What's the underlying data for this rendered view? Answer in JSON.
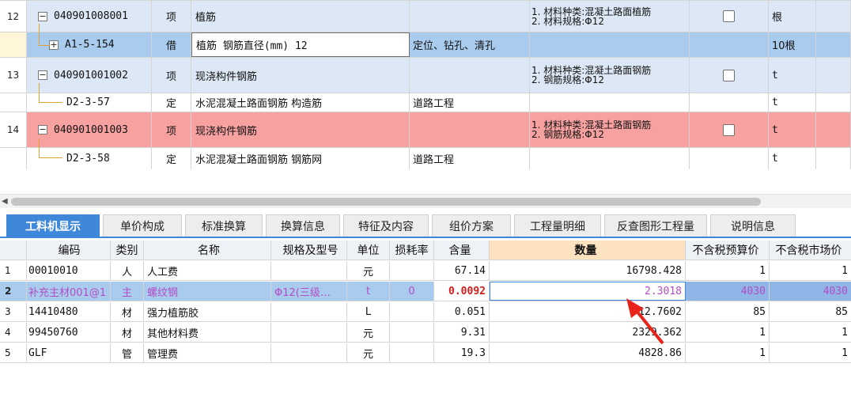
{
  "colors": {
    "accent": "#3f87d8",
    "row_highlight": "#a9cbee",
    "row_red": "#f7a1a1",
    "row_blue": "#dde8f6",
    "arrow": "#e8231a",
    "material_text": "#b44cc6"
  },
  "top_rows": [
    {
      "row_no": "12",
      "expander": "−",
      "code": "040901008001",
      "type": "项",
      "name": "植筋",
      "profession": "",
      "features": [
        "1. 材料种类:混凝土路面植筋",
        "2. 材料规格:Φ12"
      ],
      "has_checkbox": true,
      "unit": "根"
    },
    {
      "row_no": "",
      "expander": "+",
      "code": "A1-5-154",
      "type": "借",
      "name": "植筋 钢筋直径(mm) 12",
      "profession": "定位、钻孔、清孔",
      "features": [],
      "has_checkbox": false,
      "unit": "10根"
    },
    {
      "row_no": "13",
      "expander": "−",
      "code": "040901001002",
      "type": "项",
      "name": "现浇构件钢筋",
      "profession": "",
      "features": [
        "1. 材料种类:混凝土路面钢筋",
        "2. 钢筋规格:Φ12"
      ],
      "has_checkbox": true,
      "unit": "t"
    },
    {
      "row_no": "",
      "expander": "",
      "code": "D2-3-57",
      "type": "定",
      "name": "水泥混凝土路面钢筋 构造筋",
      "profession": "道路工程",
      "features": [],
      "has_checkbox": false,
      "unit": "t"
    },
    {
      "row_no": "14",
      "expander": "−",
      "code": "040901001003",
      "type": "项",
      "name": "现浇构件钢筋",
      "profession": "",
      "features": [
        "1. 材料种类:混凝土路面钢筋",
        "2. 钢筋规格:Φ12"
      ],
      "has_checkbox": true,
      "unit": "t"
    },
    {
      "row_no": "",
      "expander": "",
      "code": "D2-3-58",
      "type": "定",
      "name": "水泥混凝土路面钢筋 钢筋网",
      "profession": "道路工程",
      "features": [],
      "has_checkbox": false,
      "unit": "t"
    }
  ],
  "tabs": [
    {
      "label": "工料机显示",
      "active": true
    },
    {
      "label": "单价构成",
      "active": false
    },
    {
      "label": "标准换算",
      "active": false
    },
    {
      "label": "换算信息",
      "active": false
    },
    {
      "label": "特征及内容",
      "active": false
    },
    {
      "label": "组价方案",
      "active": false
    },
    {
      "label": "工程量明细",
      "active": false
    },
    {
      "label": "反查图形工程量",
      "active": false
    },
    {
      "label": "说明信息",
      "active": false
    }
  ],
  "bottom_table": {
    "columns": {
      "code": "编码",
      "category": "类别",
      "name": "名称",
      "spec": "规格及型号",
      "unit": "单位",
      "loss": "损耗率",
      "content": "含量",
      "quantity": "数量",
      "budget_price": "不含税预算价",
      "market_price": "不含税市场价"
    },
    "rows": [
      {
        "no": "1",
        "code": "00010010",
        "category": "人",
        "name": "人工费",
        "spec": "",
        "unit": "元",
        "loss": "",
        "content": "67.14",
        "quantity": "16798.428",
        "budget_price": "1",
        "market_price": "1"
      },
      {
        "no": "2",
        "code": "补充主材001@1",
        "category": "主",
        "name": "螺纹钢",
        "spec": "Φ12(三级…",
        "unit": "t",
        "loss": "0",
        "content": "0.0092",
        "quantity": "2.3018",
        "budget_price": "4030",
        "market_price": "4030"
      },
      {
        "no": "3",
        "code": "14410480",
        "category": "材",
        "name": "强力植筋胶",
        "spec": "",
        "unit": "L",
        "loss": "",
        "content": "0.051",
        "quantity": "12.7602",
        "budget_price": "85",
        "market_price": "85"
      },
      {
        "no": "4",
        "code": "99450760",
        "category": "材",
        "name": "其他材料费",
        "spec": "",
        "unit": "元",
        "loss": "",
        "content": "9.31",
        "quantity": "2329.362",
        "budget_price": "1",
        "market_price": "1"
      },
      {
        "no": "5",
        "code": "GLF",
        "category": "管",
        "name": "管理费",
        "spec": "",
        "unit": "元",
        "loss": "",
        "content": "19.3",
        "quantity": "4828.86",
        "budget_price": "1",
        "market_price": "1"
      }
    ]
  }
}
